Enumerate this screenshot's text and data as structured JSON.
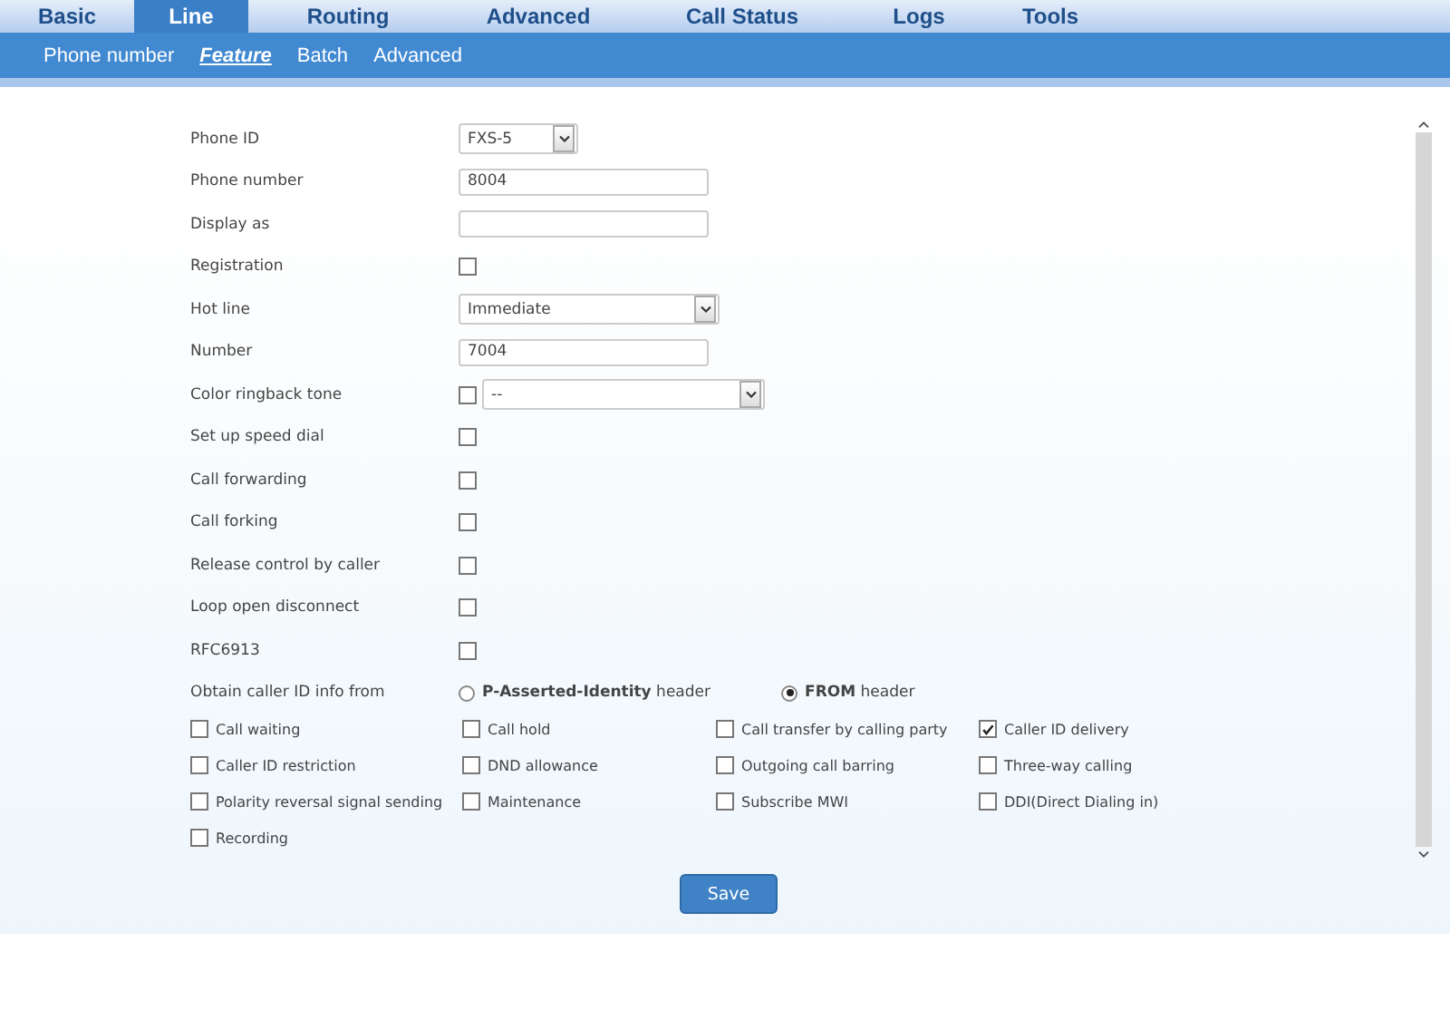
{
  "tabs": [
    {
      "label": "Basic",
      "selected": false
    },
    {
      "label": "Line",
      "selected": true
    },
    {
      "label": "Routing",
      "selected": false
    },
    {
      "label": "Advanced",
      "selected": false
    },
    {
      "label": "Call Status",
      "selected": false
    },
    {
      "label": "Logs",
      "selected": false
    },
    {
      "label": "Tools",
      "selected": false
    }
  ],
  "subtabs": [
    {
      "label": "Phone number",
      "selected": false
    },
    {
      "label": "Feature",
      "selected": true
    },
    {
      "label": "Batch",
      "selected": false
    },
    {
      "label": "Advanced",
      "selected": false
    }
  ],
  "fields": [
    {
      "label": "Phone ID",
      "kind": "short-select",
      "value": "FXS-5"
    },
    {
      "label": "Phone number",
      "kind": "text",
      "value": "8004"
    },
    {
      "label": "Display as",
      "kind": "text"
    },
    {
      "label": "Registration",
      "kind": "checkbox",
      "checked": false
    },
    {
      "label": "Hot line",
      "kind": "select",
      "value": "Immediate"
    },
    {
      "label": "Number",
      "kind": "text",
      "value": "7004"
    },
    {
      "label": "Color ringback tone",
      "kind": "check-select",
      "checked": false,
      "value": "--"
    },
    {
      "label": "Set up speed dial",
      "kind": "checkbox",
      "checked": false
    },
    {
      "label": "Call forwarding",
      "kind": "checkbox",
      "checked": false
    },
    {
      "label": "Call forking",
      "kind": "checkbox",
      "checked": false
    },
    {
      "label": "Release control by caller",
      "kind": "checkbox",
      "checked": false
    },
    {
      "label": "Loop open disconnect",
      "kind": "checkbox",
      "checked": false
    },
    {
      "label": "RFC6913",
      "kind": "checkbox",
      "checked": false
    },
    {
      "label": "Obtain caller ID info from",
      "kind": "radio",
      "options": [
        {
          "text": "**P-Asserted-Identity** header",
          "selected": false
        },
        {
          "text": "**FROM** header",
          "selected": true
        }
      ]
    }
  ],
  "options": [
    {
      "label": "Call waiting",
      "checked": false
    },
    {
      "label": "Call hold",
      "checked": false
    },
    {
      "label": "Call transfer by calling party",
      "checked": false
    },
    {
      "label": "Caller ID delivery",
      "checked": true
    },
    {
      "label": "Caller ID restriction",
      "checked": false
    },
    {
      "label": "DND allowance",
      "checked": false
    },
    {
      "label": "Outgoing call barring",
      "checked": false
    },
    {
      "label": "Three-way calling",
      "checked": false
    },
    {
      "label": "Polarity reversal signal sending",
      "checked": false
    },
    {
      "label": "Maintenance",
      "checked": false
    },
    {
      "label": "Subscribe MWI",
      "checked": false
    },
    {
      "label": "DDI(Direct Dialing in)",
      "checked": false
    },
    {
      "label": "Recording",
      "checked": false
    }
  ],
  "save_button": "Save"
}
